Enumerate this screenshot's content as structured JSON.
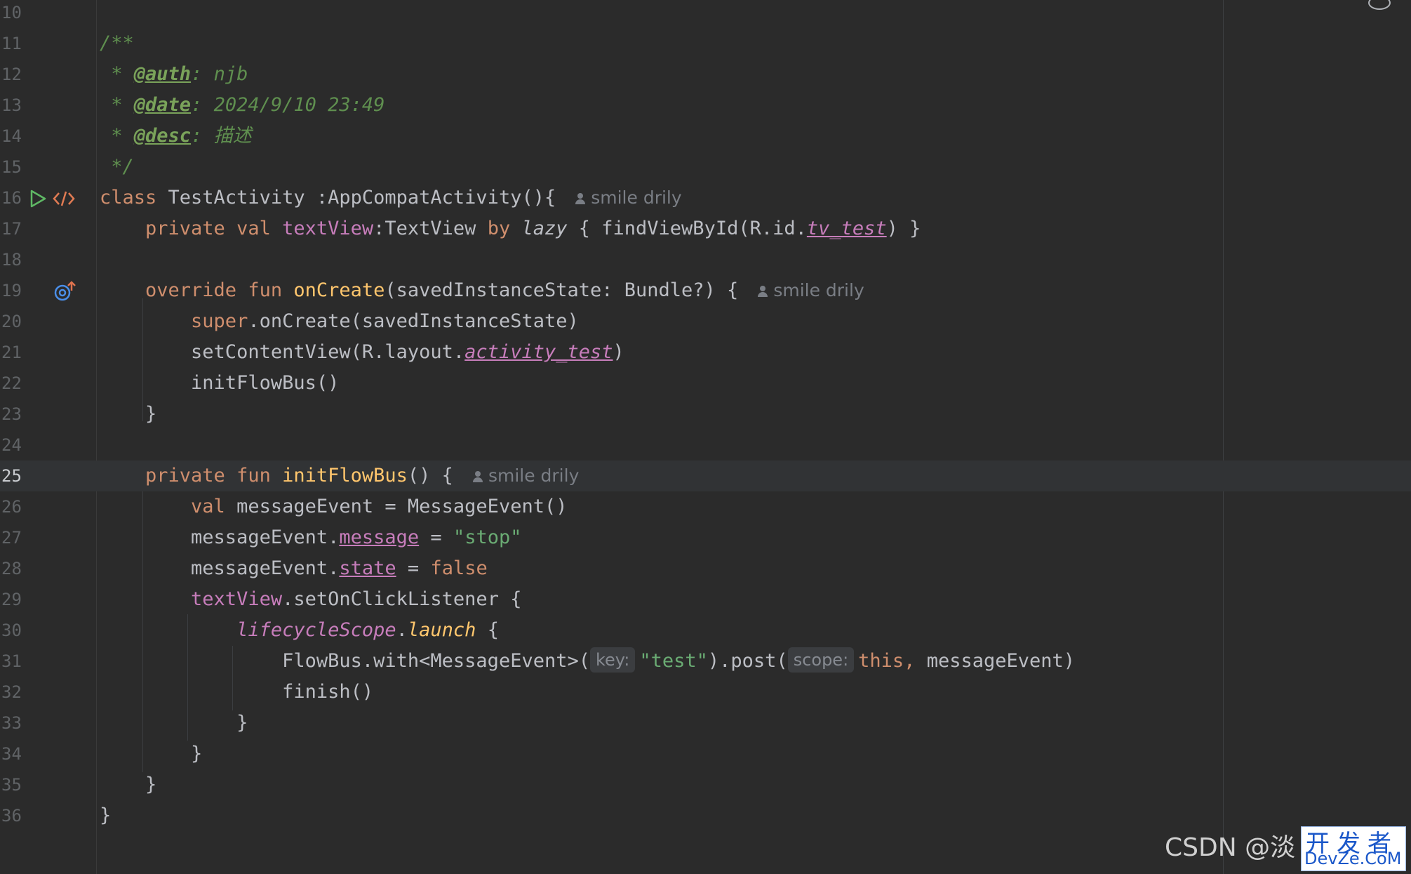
{
  "editor": {
    "lines": [
      {
        "n": "10"
      },
      {
        "n": "11"
      },
      {
        "n": "12"
      },
      {
        "n": "13"
      },
      {
        "n": "14"
      },
      {
        "n": "15"
      },
      {
        "n": "16"
      },
      {
        "n": "17"
      },
      {
        "n": "18"
      },
      {
        "n": "19"
      },
      {
        "n": "20"
      },
      {
        "n": "21"
      },
      {
        "n": "22"
      },
      {
        "n": "23"
      },
      {
        "n": "24"
      },
      {
        "n": "25"
      },
      {
        "n": "26"
      },
      {
        "n": "27"
      },
      {
        "n": "28"
      },
      {
        "n": "29"
      },
      {
        "n": "30"
      },
      {
        "n": "31"
      },
      {
        "n": "32"
      },
      {
        "n": "33"
      },
      {
        "n": "34"
      },
      {
        "n": "35"
      },
      {
        "n": "36"
      }
    ],
    "current_line": "25",
    "author_hint": "smile drily",
    "code": {
      "l11": "/**",
      "l12_star": " * ",
      "l12_tag": "@auth",
      "l12_rest": ": njb",
      "l13_star": " * ",
      "l13_tag": "@date",
      "l13_rest": ": 2024/9/10 23:49",
      "l14_star": " * ",
      "l14_tag": "@desc",
      "l14_rest": ": 描述",
      "l15": " */",
      "l16_kw": "class",
      "l16_rest": " TestActivity :AppCompatActivity(){",
      "l17_kw1": "    private val ",
      "l17_prop": "textView",
      "l17_mid": ":TextView ",
      "l17_by": "by",
      "l17_lazy": " lazy",
      "l17_call": " { findViewById(R.id.",
      "l17_id": "tv_test",
      "l17_end": ") }",
      "l19_kw": "    override fun ",
      "l19_fn": "onCreate",
      "l19_rest": "(savedInstanceState: Bundle?) {",
      "l20_kw": "        super",
      "l20_rest": ".onCreate(savedInstanceState)",
      "l21_a": "        setContentView(R.layout.",
      "l21_id": "activity_test",
      "l21_b": ")",
      "l22": "        initFlowBus()",
      "l23": "    }",
      "l25_kw": "    private fun ",
      "l25_fn": "initFlowBus",
      "l25_rest": "() {",
      "l26_kw": "        val",
      "l26_rest": " messageEvent = MessageEvent()",
      "l27_a": "        messageEvent.",
      "l27_prop": "message",
      "l27_b": " = ",
      "l27_str": "\"stop\"",
      "l28_a": "        messageEvent.",
      "l28_prop": "state",
      "l28_b": " = ",
      "l28_kw": "false",
      "l29_prop": "        textView",
      "l29_rest": ".setOnClickListener {",
      "l30_scope": "            lifecycleScope",
      "l30_dot": ".",
      "l30_launch": "launch",
      "l30_rest": " {",
      "l31_a": "                FlowBus.with<MessageEvent>(",
      "l31_hint1": "key:",
      "l31_str": "\"test\"",
      "l31_b": ").post(",
      "l31_hint2": "scope:",
      "l31_this": "this,",
      "l31_c": " messageEvent)",
      "l32": "                finish()",
      "l33": "            }",
      "l34": "        }",
      "l35": "    }",
      "l36": "}"
    }
  },
  "watermark": {
    "csdn": "CSDN @淡",
    "site_cn": "开发者",
    "site_en": "DevZe.CoM"
  },
  "colors": {
    "background": "#2b2b2b",
    "keyword": "#cf8e6d",
    "function": "#ffc66d",
    "string": "#6aab73",
    "comment": "#5f8f4f",
    "property": "#c77dbb"
  },
  "icons": [
    "run-gutter-icon",
    "code-gutter-icon",
    "override-gutter-icon",
    "hide-eye-icon",
    "person-icon"
  ]
}
